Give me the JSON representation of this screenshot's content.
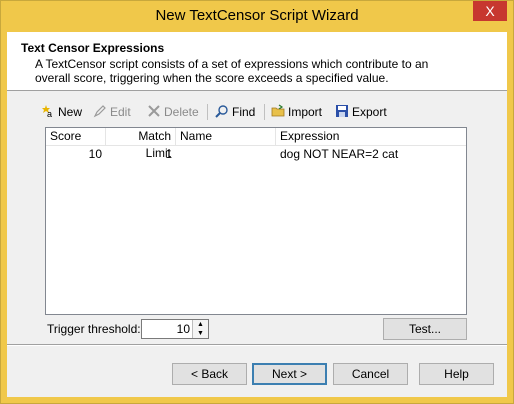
{
  "window": {
    "title": "New TextCensor Script Wizard",
    "close": "X"
  },
  "header": {
    "title": "Text Censor Expressions",
    "description": "A TextCensor script consists of a set of expressions which contribute to an overall score, triggering when the score exceeds a specified value."
  },
  "toolbar": {
    "new": "New",
    "edit": "Edit",
    "delete": "Delete",
    "find": "Find",
    "import": "Import",
    "export": "Export"
  },
  "grid": {
    "columns": [
      "Score",
      "Match Limit",
      "Name",
      "Expression"
    ],
    "rows": [
      {
        "score": "10",
        "match_limit": "1",
        "name": "",
        "expression": "dog NOT NEAR=2 cat"
      }
    ]
  },
  "trigger": {
    "label": "Trigger threshold:",
    "value": "10"
  },
  "buttons": {
    "test": "Test...",
    "back": "< Back",
    "next": "Next >",
    "cancel": "Cancel",
    "help": "Help"
  }
}
